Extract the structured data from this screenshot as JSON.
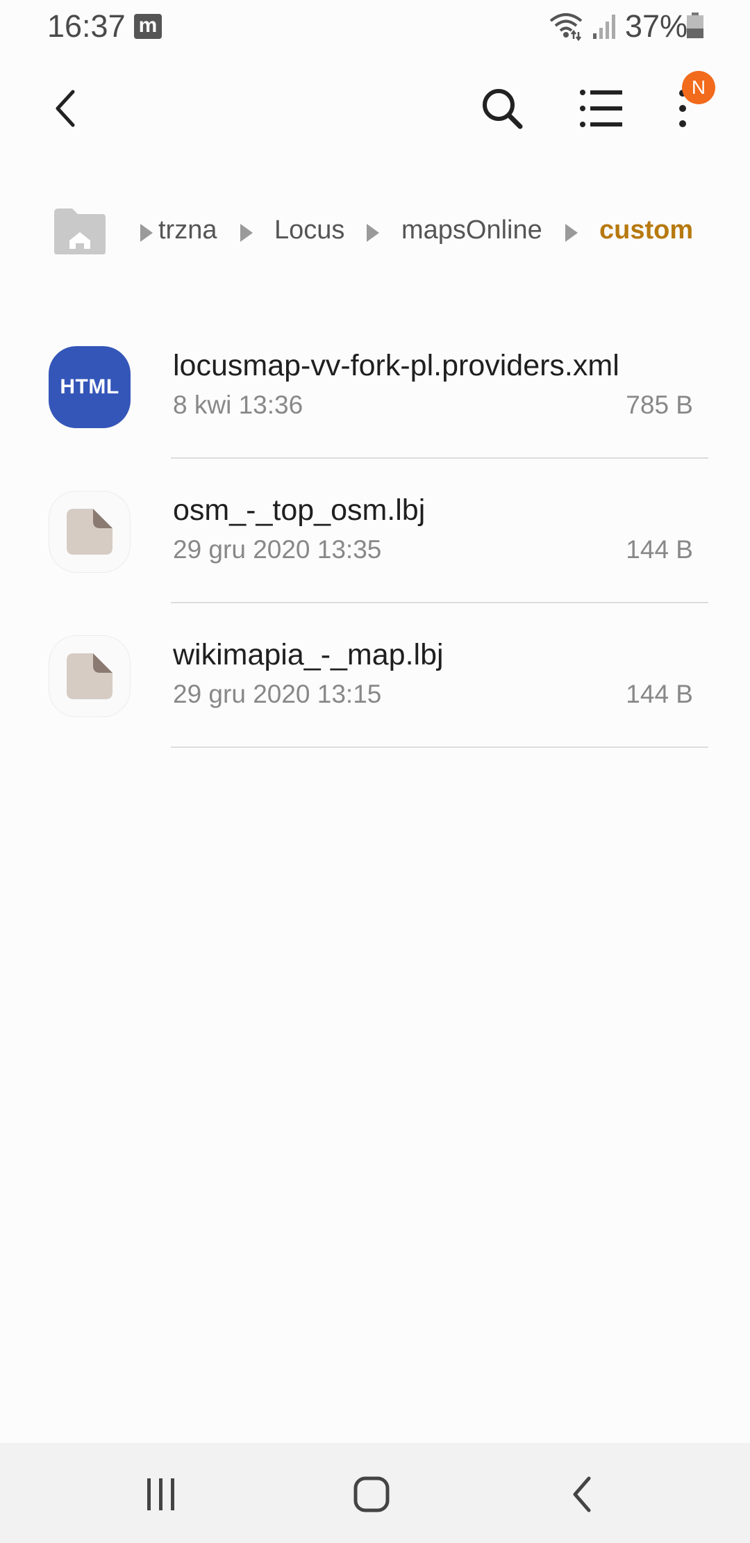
{
  "status_bar": {
    "time": "16:37",
    "notification_icon": "m",
    "battery": "37%",
    "icons": [
      "wifi-icon",
      "signal-icon",
      "battery-icon"
    ]
  },
  "app_bar": {
    "icons": [
      "back-icon",
      "search-icon",
      "list-icon",
      "more-vert-icon"
    ],
    "badge": "N"
  },
  "breadcrumb": {
    "items": [
      "trzna",
      "Locus",
      "mapsOnline"
    ],
    "current": "custom"
  },
  "files": [
    {
      "name": "locusmap-vv-fork-pl.providers.xml",
      "date": "8 kwi 13:36",
      "size": "785 B",
      "icon_label": "HTML"
    },
    {
      "name": "osm_-_top_osm.lbj",
      "date": "29 gru 2020 13:35",
      "size": "144 B"
    },
    {
      "name": "wikimapia_-_map.lbj",
      "date": "29 gru 2020 13:15",
      "size": "144 B"
    }
  ],
  "nav_bar": {
    "icons": [
      "recents-icon",
      "home-icon",
      "back-nav-icon"
    ]
  },
  "colors": {
    "accent_breadcrumb": "#b7790f",
    "html_icon_bg": "#3456b8",
    "badge_bg": "#f26a1b"
  }
}
